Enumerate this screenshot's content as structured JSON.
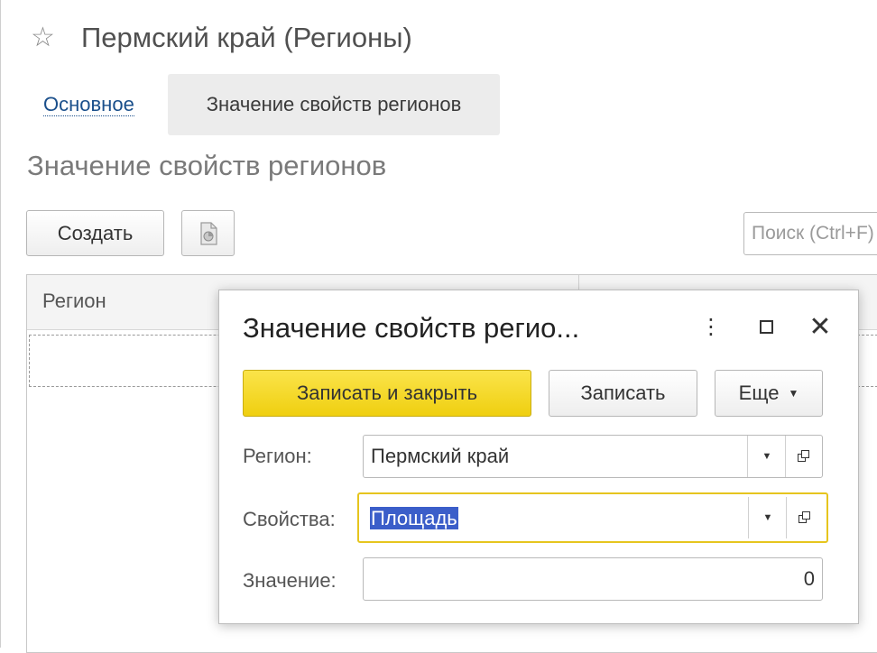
{
  "window": {
    "title": "Пермский край (Регионы)"
  },
  "tabs": [
    {
      "label": "Основное"
    },
    {
      "label": "Значение свойств регионов"
    }
  ],
  "section": {
    "title": "Значение свойств регионов"
  },
  "toolbar": {
    "create_label": "Создать",
    "search_placeholder": "Поиск (Ctrl+F)"
  },
  "table": {
    "columns": [
      "Регион"
    ]
  },
  "dialog": {
    "title": "Значение свойств регио...",
    "save_close_label": "Записать и закрыть",
    "save_label": "Записать",
    "more_label": "Еще",
    "fields": {
      "region": {
        "label": "Регион:",
        "value": "Пермский край"
      },
      "property": {
        "label": "Свойства:",
        "value": "Площадь"
      },
      "value": {
        "label": "Значение:",
        "value": "0"
      }
    }
  },
  "colors": {
    "accent_yellow": "#f5d823",
    "link": "#1a4f8b",
    "selection": "#3b5ec9"
  },
  "icons": [
    "star-icon",
    "report-icon",
    "more-vertical-icon",
    "maximize-icon",
    "close-icon",
    "dropdown-arrow-icon",
    "open-form-icon"
  ]
}
